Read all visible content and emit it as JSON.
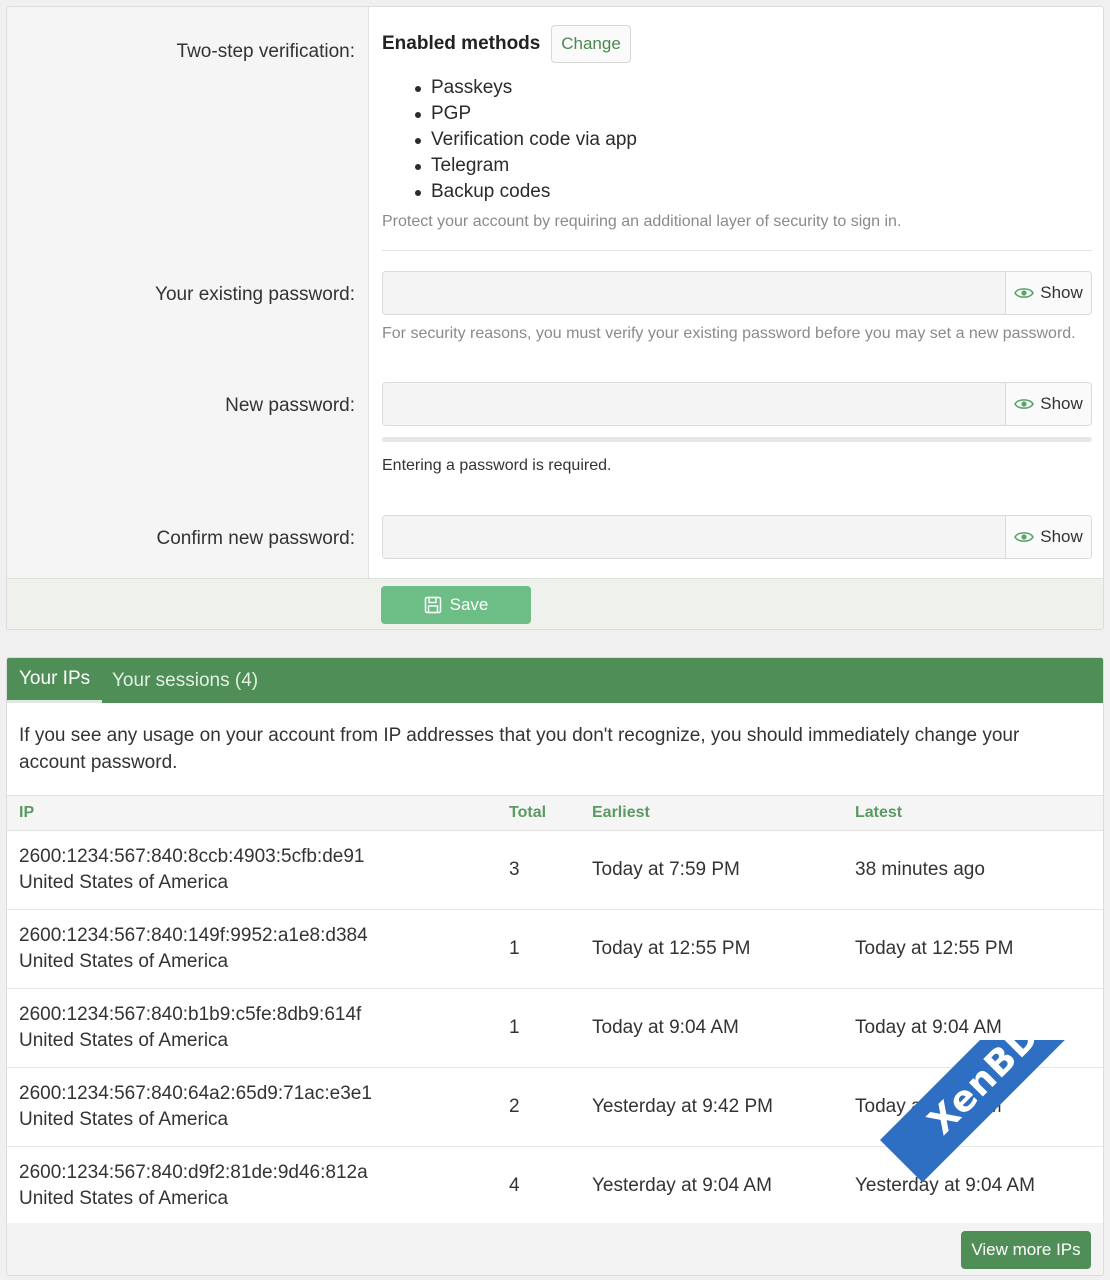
{
  "security": {
    "two_step_label": "Two-step verification:",
    "enabled_methods_title": "Enabled methods",
    "change_label": "Change",
    "methods": [
      "Passkeys",
      "PGP",
      "Verification code via app",
      "Telegram",
      "Backup codes"
    ],
    "two_step_hint": "Protect your account by requiring an additional layer of security to sign in.",
    "existing_password_label": "Your existing password:",
    "existing_password_hint": "For security reasons, you must verify your existing password before you may set a new password.",
    "new_password_label": "New password:",
    "password_required_msg": "Entering a password is required.",
    "confirm_password_label": "Confirm new password:",
    "show_label": "Show",
    "save_label": "Save"
  },
  "ips": {
    "tabs": [
      {
        "label": "Your IPs",
        "active": true
      },
      {
        "label": "Your sessions (4)",
        "active": false
      }
    ],
    "notice": "If you see any usage on your account from IP addresses that you don't recognize, you should immediately change your account password.",
    "columns": [
      "IP",
      "Total",
      "Earliest",
      "Latest"
    ],
    "rows": [
      {
        "ip": "2600:1234:567:840:8ccb:4903:5cfb:de91",
        "location": "United States of America",
        "total": "3",
        "earliest": "Today at 7:59 PM",
        "latest": "38 minutes ago"
      },
      {
        "ip": "2600:1234:567:840:149f:9952:a1e8:d384",
        "location": "United States of America",
        "total": "1",
        "earliest": "Today at 12:55 PM",
        "latest": "Today at 12:55 PM"
      },
      {
        "ip": "2600:1234:567:840:b1b9:c5fe:8db9:614f",
        "location": "United States of America",
        "total": "1",
        "earliest": "Today at 9:04 AM",
        "latest": "Today at 9:04 AM"
      },
      {
        "ip": "2600:1234:567:840:64a2:65d9:71ac:e3e1",
        "location": "United States of America",
        "total": "2",
        "earliest": "Yesterday at 9:42 PM",
        "latest": "Today at 8:05 AM"
      },
      {
        "ip": "2600:1234:567:840:d9f2:81de:9d46:812a",
        "location": "United States of America",
        "total": "4",
        "earliest": "Yesterday at 9:04 AM",
        "latest": "Yesterday at 9:04 AM"
      }
    ],
    "view_more_label": "View more IPs"
  },
  "watermark": "XenBD.Com",
  "colors": {
    "accent": "#4f8f57",
    "save_button": "#6dbd87",
    "watermark": "#2e6fc3"
  }
}
